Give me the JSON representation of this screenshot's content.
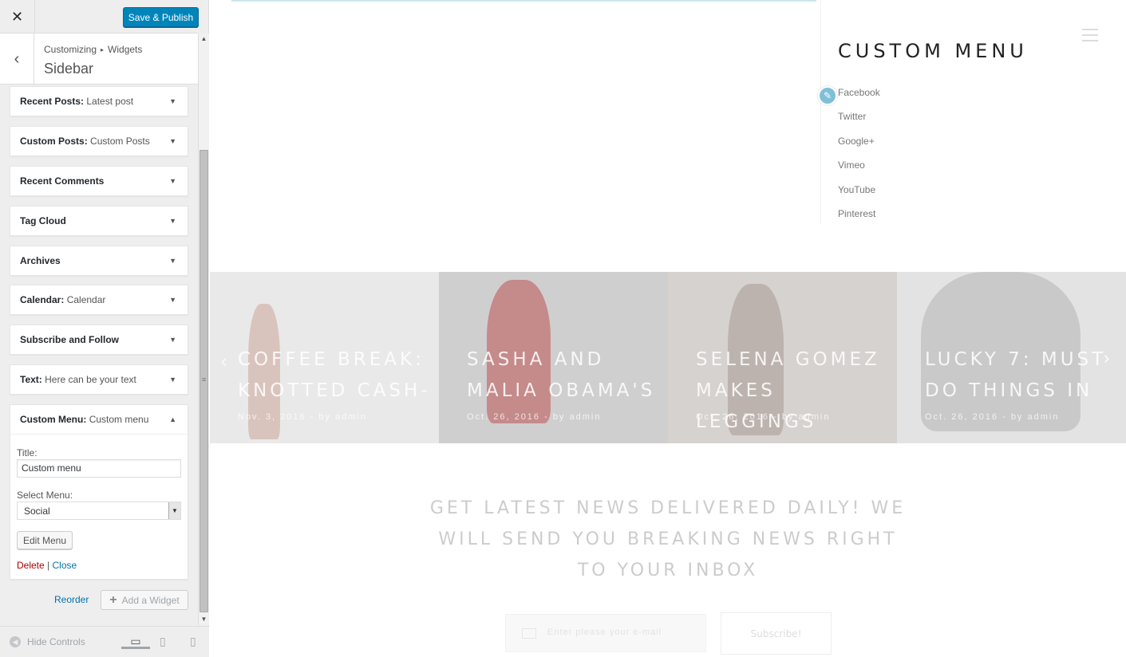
{
  "topbar": {
    "close_glyph": "✕",
    "publish_label": "Save & Publish"
  },
  "section": {
    "back_glyph": "‹",
    "breadcrumb_root": "Customizing",
    "breadcrumb_sep": "▸",
    "breadcrumb_leaf": "Widgets",
    "title": "Sidebar"
  },
  "widgets": [
    {
      "name": "Recent Posts",
      "sub": "Latest post"
    },
    {
      "name": "Custom Posts",
      "sub": "Custom Posts"
    },
    {
      "name": "Recent Comments",
      "sub": ""
    },
    {
      "name": "Tag Cloud",
      "sub": ""
    },
    {
      "name": "Archives",
      "sub": ""
    },
    {
      "name": "Calendar",
      "sub": "Calendar"
    },
    {
      "name": "Subscribe and Follow",
      "sub": ""
    },
    {
      "name": "Text",
      "sub": "Here can be your text"
    }
  ],
  "open_widget": {
    "name": "Custom Menu",
    "sub": "Custom menu",
    "title_label": "Title:",
    "title_value": "Custom menu",
    "menu_label": "Select Menu:",
    "menu_value": "Social",
    "edit_menu_label": "Edit Menu",
    "delete_label": "Delete",
    "pipe": "|",
    "close_label": "Close"
  },
  "toggle_closed": "▼",
  "toggle_open": "▲",
  "reorder_label": "Reorder",
  "add_widget_label": "Add a Widget",
  "footer": {
    "hide_controls": "Hide Controls"
  },
  "preview": {
    "menu_title": "CUSTOM MENU",
    "social_links": [
      "Facebook",
      "Twitter",
      "Google+",
      "Vimeo",
      "YouTube",
      "Pinterest"
    ],
    "slides": [
      {
        "title": "COFFEE BREAK:\nKNOTTED CASH-",
        "meta": "Nov. 3, 2016  -  by admin",
        "bg": "#e9e9e9",
        "figure": "#d9c4bd"
      },
      {
        "title": "SASHA AND\nMALIA OBAMA'S",
        "meta": "Oct. 26, 2016  -  by admin",
        "bg": "#cfcfcf",
        "figure": "#c58a8a"
      },
      {
        "title": "SELENA GOMEZ\nMAKES LEGGINGS",
        "meta": "Oct. 26, 2016  -  by admin",
        "bg": "#d6d2cf",
        "figure": "#bdb3ae"
      },
      {
        "title": "LUCKY 7: MUST\nDO THINGS IN",
        "meta": "Oct. 26, 2016  -  by admin",
        "bg": "#e3e3e3",
        "figure": "#c9c9c9"
      }
    ],
    "newsletter": "GET LATEST NEWS DELIVERED DAILY! WE WILL SEND YOU BREAKING NEWS RIGHT TO YOUR INBOX",
    "email_placeholder": "Enter please your e-mail",
    "subscribe_label": "Subscribe!"
  },
  "colors": {
    "primary": "#0085ba",
    "link": "#0073aa",
    "delete": "#aa0000"
  }
}
